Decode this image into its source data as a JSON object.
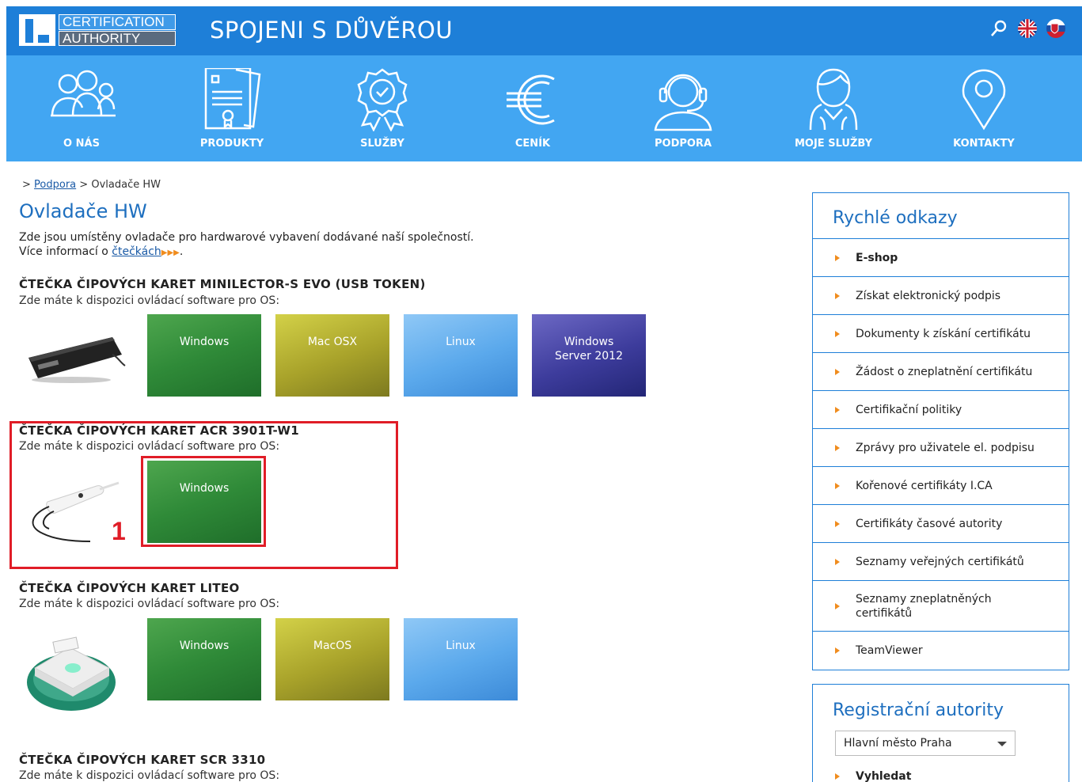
{
  "header": {
    "logo_top": "CERTIFICATION",
    "logo_bottom": "AUTHORITY",
    "slogan": "SPOJENI S DŮVĚROU",
    "icons": [
      "search-icon",
      "flag-uk-icon",
      "flag-sk-icon"
    ]
  },
  "nav": {
    "items": [
      {
        "label": "O NÁS",
        "icon": "people-icon"
      },
      {
        "label": "PRODUKTY",
        "icon": "documents-icon"
      },
      {
        "label": "SLUŽBY",
        "icon": "award-icon"
      },
      {
        "label": "CENÍK",
        "icon": "euro-icon"
      },
      {
        "label": "PODPORA",
        "icon": "headset-icon"
      },
      {
        "label": "MOJE SLUŽBY",
        "icon": "user-icon"
      },
      {
        "label": "KONTAKTY",
        "icon": "location-pin-icon"
      }
    ]
  },
  "breadcrumb": {
    "prefix": ">",
    "link": "Podpora",
    "sep": ">",
    "current": "Ovladače HW"
  },
  "page": {
    "title": "Ovladače HW",
    "intro_line1": "Zde jsou umístěny ovladače pro hardwarové vybavení dodávané naší společností.",
    "intro_line2_prefix": "Více informací o",
    "intro_link": "čtečkách",
    "intro_arrows": "▶▶▶",
    "intro_suffix": "."
  },
  "sections": [
    {
      "title": "ČTEČKA ČIPOVÝCH KARET MINILECTOR-S EVO (USB TOKEN)",
      "subtitle": "Zde máte k dispozici ovládací software pro OS:",
      "tiles": [
        "Windows",
        "Mac OSX",
        "Linux",
        "Windows Server 2012"
      ]
    },
    {
      "title": "ČTEČKA ČIPOVÝCH KARET ACR 3901T-W1",
      "subtitle": "Zde máte k dispozici ovládací software pro OS:",
      "tiles": [
        "Windows"
      ]
    },
    {
      "title": "ČTEČKA ČIPOVÝCH KARET LITEO",
      "subtitle": "Zde máte k dispozici ovládací software pro OS:",
      "tiles": [
        "Windows",
        "MacOS",
        "Linux"
      ]
    },
    {
      "title": "ČTEČKA ČIPOVÝCH KARET SCR 3310",
      "subtitle": "Zde máte k dispozici ovládací software pro OS:"
    }
  ],
  "annotation": {
    "marker": "1",
    "color": "#e01d27"
  },
  "quick_links": {
    "title": "Rychlé odkazy",
    "items": [
      "E-shop",
      "Získat elektronický podpis",
      "Dokumenty k získání certifikátu",
      "Žádost o zneplatnění certifikátu",
      "Certifikační politiky",
      "Zprávy pro uživatele el. podpisu",
      "Kořenové certifikáty I.CA",
      "Certifikáty časové autority",
      "Seznamy veřejných certifikátů",
      "Seznamy zneplatněných certifikátů",
      "TeamViewer"
    ]
  },
  "registration": {
    "title": "Registrační autority",
    "select_value": "Hlavní město Praha",
    "search_label": "Vyhledat"
  },
  "colors": {
    "header_blue": "#1e7fd8",
    "nav_blue": "#42a6f2",
    "accent_orange": "#f08c1e",
    "title_blue": "#1e6fbf"
  }
}
